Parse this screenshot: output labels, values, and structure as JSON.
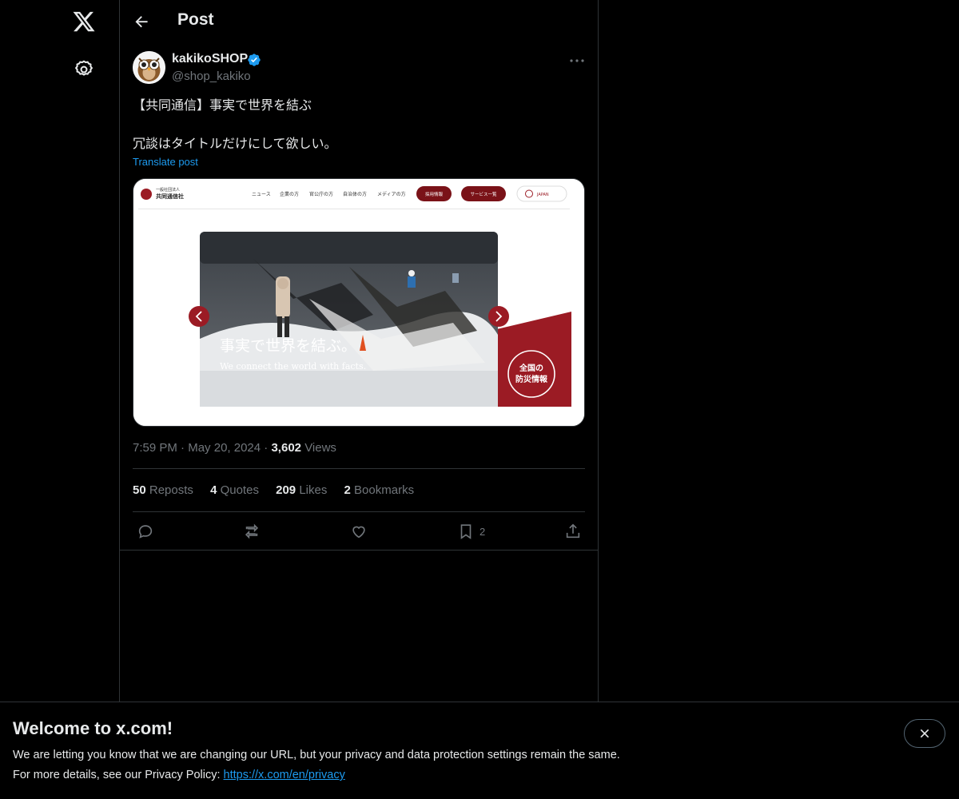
{
  "header": {
    "title": "Post"
  },
  "author": {
    "name": "kakikoSHOP",
    "handle": "@shop_kakiko"
  },
  "tweet": {
    "text": "【共同通信】事実で世界を結ぶ\n\n冗談はタイトルだけにして欲しい。",
    "translate_label": "Translate post"
  },
  "media": {
    "logo_line1": "一般社団法人",
    "logo_line2": "共同通信社",
    "nav": [
      "ニュース",
      "企業の方",
      "官公庁の方",
      "自治体の方",
      "メディアの方"
    ],
    "btn_recruit": "採用情報",
    "btn_services": "サービス一覧",
    "lang": "JAPAN",
    "headline": "事実で世界を結ぶ。",
    "subline": "We connect the world with facts.",
    "badge_line1": "全国の",
    "badge_line2": "防災情報"
  },
  "meta": {
    "time": "7:59 PM",
    "date": "May 20, 2024",
    "views_count": "3,602",
    "views_label": "Views"
  },
  "stats": {
    "reposts_count": "50",
    "reposts_label": "Reposts",
    "quotes_count": "4",
    "quotes_label": "Quotes",
    "likes_count": "209",
    "likes_label": "Likes",
    "bookmarks_count": "2",
    "bookmarks_label": "Bookmarks"
  },
  "actions": {
    "bookmark_count": "2"
  },
  "banner": {
    "title": "Welcome to x.com!",
    "line1": "We are letting you know that we are changing our URL, but your privacy and data protection settings remain the same.",
    "line2_prefix": "For more details, see our Privacy Policy: ",
    "link": "https://x.com/en/privacy"
  },
  "colors": {
    "background": "#000000",
    "text": "#e7e9ea",
    "muted": "#71767b",
    "link": "#1d9bf0",
    "verified": "#1d9bf0",
    "brand_red": "#9b1b24"
  },
  "icons": [
    "x-logo-icon",
    "gear-icon",
    "back-arrow-icon",
    "verified-badge-icon",
    "more-icon",
    "reply-icon",
    "repost-icon",
    "like-icon",
    "bookmark-icon",
    "share-icon",
    "close-icon"
  ]
}
